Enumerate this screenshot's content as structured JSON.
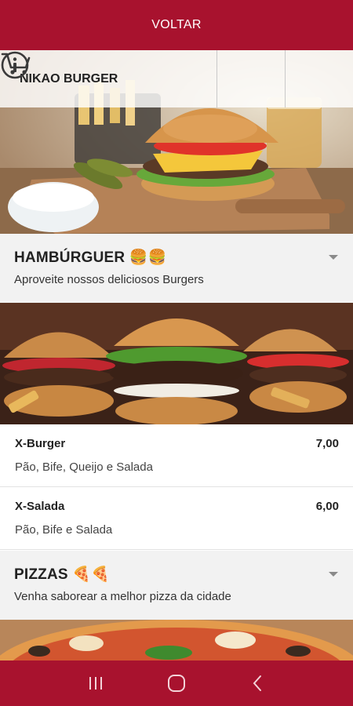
{
  "header": {
    "back_label": "VOLTAR"
  },
  "store": {
    "name": "NIKAO BURGER",
    "info_icon": "info-circle-icon",
    "cart_icon": "cart-icon"
  },
  "categories": [
    {
      "title": "HAMBÚRGUER 🍔🍔",
      "description": "Aproveite nossos deliciosos Burgers",
      "items": [
        {
          "name": "X-Burger",
          "price": "7,00",
          "description": "Pão, Bife, Queijo e Salada"
        },
        {
          "name": "X-Salada",
          "price": "6,00",
          "description": "Pão, Bife e Salada"
        }
      ]
    },
    {
      "title": "PIZZAS 🍕🍕",
      "description": "Venha saborear a melhor pizza da cidade",
      "items": []
    }
  ],
  "colors": {
    "brand": "#a8122e",
    "category_bg": "#f2f2f2"
  },
  "system_nav": {
    "icons": [
      "recent-apps-icon",
      "home-icon",
      "back-icon"
    ]
  }
}
